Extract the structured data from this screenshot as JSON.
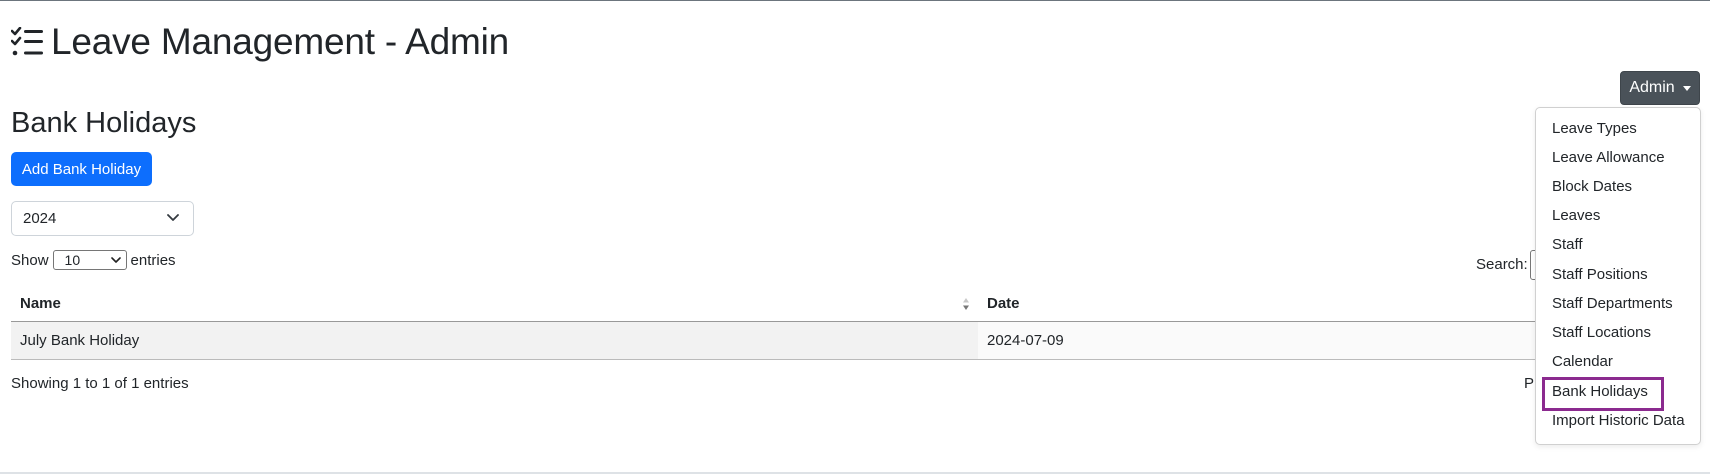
{
  "app": {
    "title": "Leave Management - Admin",
    "icon": "checklist-icon"
  },
  "user_menu": {
    "label": "Admin",
    "items": [
      "Leave Types",
      "Leave Allowance",
      "Block Dates",
      "Leaves",
      "Staff",
      "Staff Positions",
      "Staff Departments",
      "Staff Locations",
      "Calendar",
      "Bank Holidays",
      "Import Historic Data"
    ],
    "active_item": "Bank Holidays",
    "highlight_color": "#8b2a8f"
  },
  "page": {
    "title": "Bank Holidays",
    "add_button": "Add Bank Holiday",
    "year_select": "2024"
  },
  "table_controls": {
    "show_label": "Show",
    "entries_value": "10",
    "entries_label": "entries",
    "search_label": "Search:",
    "search_value": ""
  },
  "table": {
    "columns": [
      "Name",
      "Date"
    ],
    "rows": [
      {
        "name": "July Bank Holiday",
        "date": "2024-07-09"
      }
    ],
    "info": "Showing 1 to 1 of 1 entries",
    "pager_visible_text": "Pr"
  },
  "colors": {
    "primary": "#0d6efd",
    "admin_button": "#4a5259"
  }
}
